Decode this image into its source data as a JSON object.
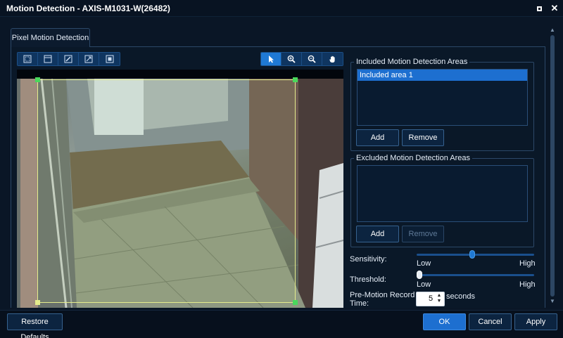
{
  "window": {
    "title": "Motion Detection - AXIS-M1031-W(26482)",
    "controls": [
      "maximize-icon",
      "close-icon"
    ]
  },
  "tab": {
    "label": "Pixel Motion Detection"
  },
  "toolbar": {
    "shape_tools": [
      "add-area-icon",
      "add-rect-icon",
      "edit-area-icon",
      "resize-area-icon",
      "full-area-icon"
    ],
    "view_tools": [
      "pointer-icon",
      "zoom-in-icon",
      "zoom-out-icon",
      "pan-hand-icon"
    ],
    "active_tool": "pointer-icon"
  },
  "included": {
    "title": "Included Motion Detection Areas",
    "items": [
      "Included area 1"
    ],
    "add_label": "Add",
    "remove_label": "Remove"
  },
  "excluded": {
    "title": "Excluded Motion Detection Areas",
    "items": [],
    "add_label": "Add",
    "remove_label": "Remove"
  },
  "sensitivity": {
    "label": "Sensitivity:",
    "low": "Low",
    "high": "High",
    "value": 0.47
  },
  "threshold": {
    "label": "Threshold:",
    "low": "Low",
    "high": "High",
    "value": 0.0
  },
  "pre_motion": {
    "label_line1": "Pre-Motion Record",
    "label_line2": "Time:",
    "value": "5",
    "unit": "seconds"
  },
  "footer": {
    "restore_label": "Restore Defaults",
    "ok_label": "OK",
    "cancel_label": "Cancel",
    "apply_label": "Apply"
  },
  "colors": {
    "accent": "#1f79d4",
    "area_outline": "#e4ec8c",
    "area_handle": "#49d85c"
  }
}
